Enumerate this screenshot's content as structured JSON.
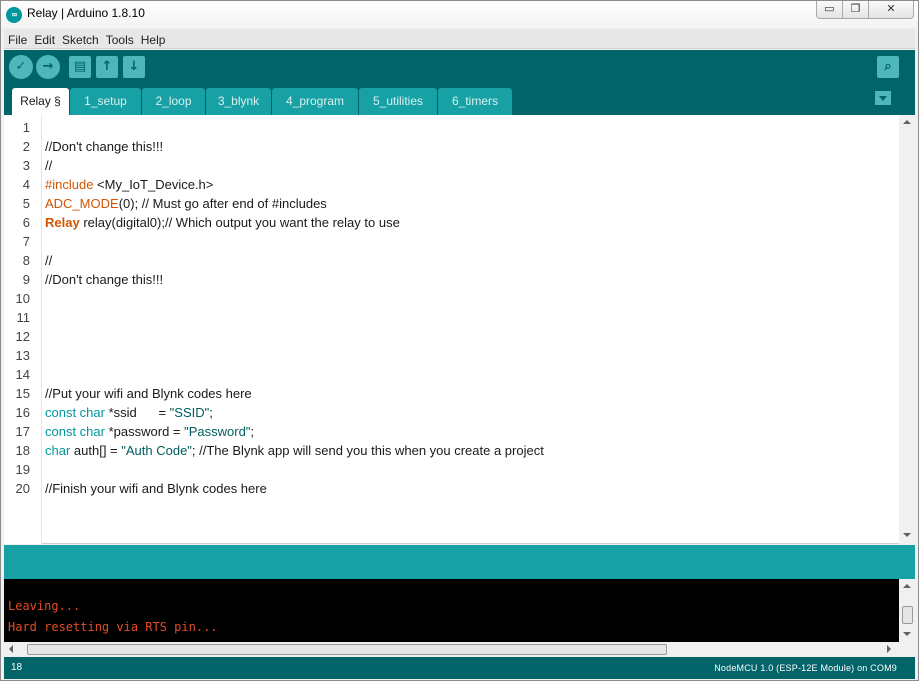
{
  "window": {
    "title": "Relay | Arduino 1.8.10",
    "app_icon_glyph": "∞",
    "minimize_glyph": "▭",
    "maximize_glyph": "❐",
    "close_glyph": "✕"
  },
  "menubar": {
    "items": [
      "File",
      "Edit",
      "Sketch",
      "Tools",
      "Help"
    ]
  },
  "toolbar": {
    "verify_icon": "✓",
    "upload_icon": "→",
    "new_icon": "▤",
    "open_icon": "↑",
    "save_icon": "↓",
    "serial_monitor_icon": "⌕"
  },
  "tabs": [
    {
      "label": "Relay §",
      "active": true
    },
    {
      "label": "1_setup",
      "active": false
    },
    {
      "label": "2_loop",
      "active": false
    },
    {
      "label": "3_blynk",
      "active": false
    },
    {
      "label": "4_program",
      "active": false
    },
    {
      "label": "5_utilities",
      "active": false
    },
    {
      "label": "6_timers",
      "active": false
    }
  ],
  "editor": {
    "line_numbers": [
      "1",
      "2",
      "3",
      "4",
      "5",
      "6",
      "7",
      "8",
      "9",
      "10",
      "11",
      "12",
      "13",
      "14",
      "15",
      "16",
      "17",
      "18",
      "19",
      "20"
    ],
    "lines": {
      "l2": "//Don't change this!!!",
      "l3": "//",
      "l4_kw": "#include",
      "l4_rest": " <My_IoT_Device.h>",
      "l5_kw": "ADC_MODE",
      "l5_rest": "(0); // Must go after end of #includes",
      "l6_kw": "Relay",
      "l6_rest": " relay(digital0);// Which output you want the relay to use",
      "l8": "//",
      "l9": "//Don't change this!!!",
      "l15": "//Put your wifi and Blynk codes here",
      "l16_kw": "const char",
      "l16_mid": " *ssid      = ",
      "l16_str": "\"SSID\"",
      "l16_end": ";",
      "l17_kw": "const char",
      "l17_mid": " *password = ",
      "l17_str": "\"Password\"",
      "l17_end": ";",
      "l18_kw": "char",
      "l18_mid": " auth[] = ",
      "l18_str": "\"Auth Code\"",
      "l18_end": "; //The Blynk app will send you this when you create a project",
      "l20": "//Finish your wifi and Blynk codes here"
    }
  },
  "console": {
    "lines": [
      "Leaving...",
      "Hard resetting via RTS pin..."
    ]
  },
  "statusbar": {
    "line_number": "18",
    "board": "NodeMCU 1.0 (ESP-12E Module) on COM9"
  },
  "colors": {
    "toolbar_bg": "#006468",
    "tab_bg": "#17a1a5",
    "keyword_teal": "#00979d",
    "keyword_orange": "#d35400",
    "console_text": "#e34c22"
  }
}
